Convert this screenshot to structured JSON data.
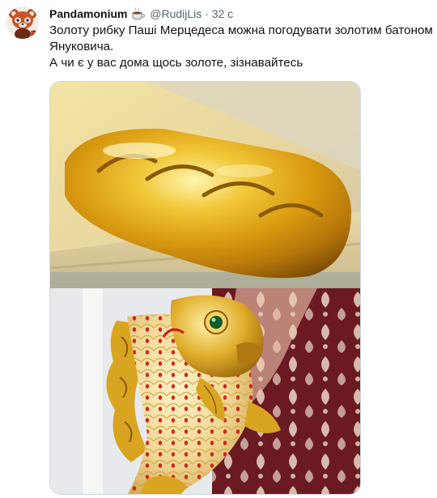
{
  "tweet": {
    "author_name": "Pandamonium",
    "author_emoji": "coffee-cup-icon",
    "handle": "@RudijLis",
    "separator": "·",
    "time": "32 с",
    "text_line_1": "Золоту рибку Паші Мерцедеса можна погодувати золотим батоном Януковича.",
    "text_line_2": "А чи є у вас дома щось золоте, зізнавайтесь"
  },
  "media": {
    "image_1": "golden-bread-loaf-photo",
    "image_2": "golden-fish-figurine-photo"
  },
  "colors": {
    "text": "#0f1419",
    "secondary": "#536471",
    "gold": "#d9a520",
    "fish_red": "#c8201a"
  }
}
